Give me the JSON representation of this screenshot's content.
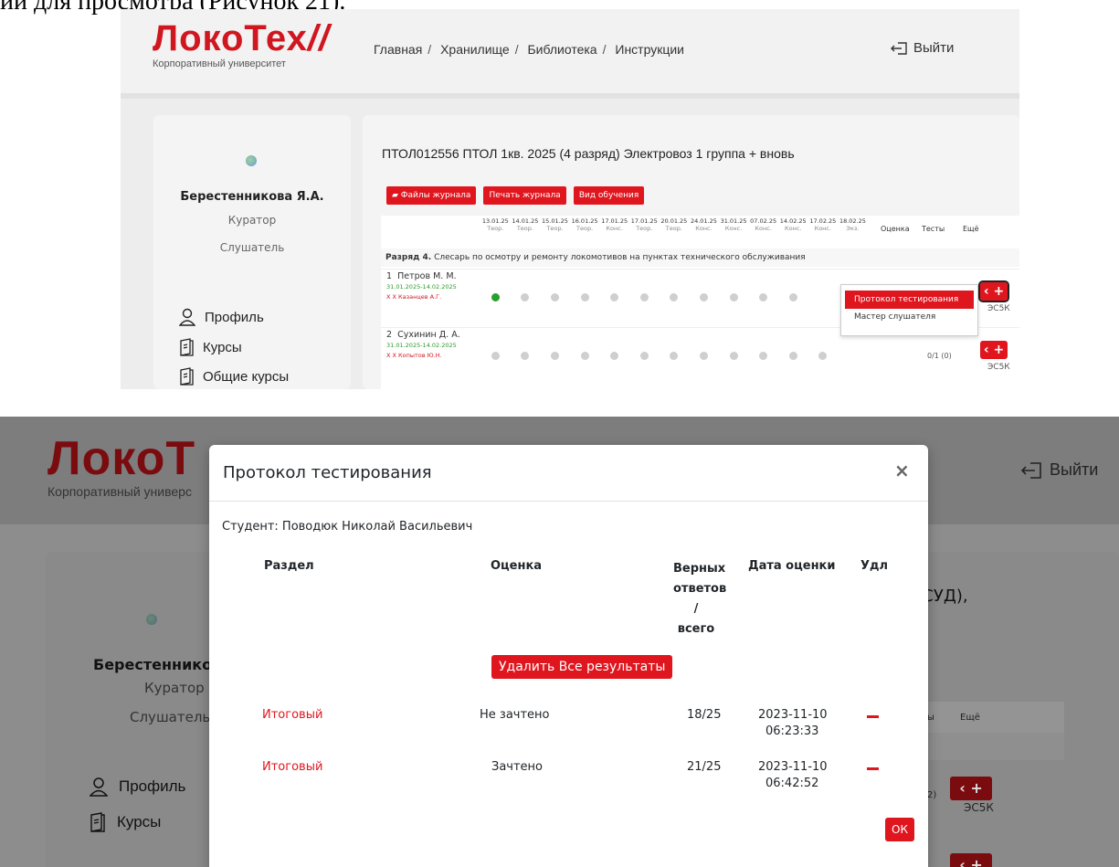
{
  "caption": "ии для просмотра (Рисунок 21).",
  "top": {
    "logo": {
      "brand": "ЛокоТех",
      "slash": "//",
      "subtitle": "Корпоративный университет"
    },
    "nav": [
      "Главная",
      "Хранилище",
      "Библиотека",
      "Инструкции"
    ],
    "logout_label": "Выйти",
    "user": {
      "name": "Берестенникова Я.А.",
      "role1": "Куратор",
      "role2": "Слушатель"
    },
    "menu": [
      "Профиль",
      "Курсы",
      "Общие курсы"
    ],
    "course_title": "ПТОЛ012556  ПТОЛ 1кв. 2025 (4 разряд) Электровоз 1 группа + вновь",
    "buttons": {
      "files": "Файлы журнала",
      "print": "Печать журнала",
      "study": "Вид обучения"
    },
    "dates": [
      {
        "d": "13.01.25",
        "t": "Теор."
      },
      {
        "d": "14.01.25",
        "t": "Теор."
      },
      {
        "d": "15.01.25",
        "t": "Теор."
      },
      {
        "d": "16.01.25",
        "t": "Теор."
      },
      {
        "d": "17.01.25",
        "t": "Конс."
      },
      {
        "d": "17.01.25",
        "t": "Теор."
      },
      {
        "d": "20.01.25",
        "t": "Теор."
      },
      {
        "d": "24.01.25",
        "t": "Конс."
      },
      {
        "d": "31.01.25",
        "t": "Конс."
      },
      {
        "d": "07.02.25",
        "t": "Конс."
      },
      {
        "d": "14.02.25",
        "t": "Конс."
      },
      {
        "d": "17.02.25",
        "t": "Конс."
      },
      {
        "d": "18.02.25",
        "t": "Экз."
      }
    ],
    "headers": {
      "grade": "Оценка",
      "tests": "Тесты",
      "more": "Ещё"
    },
    "rank": {
      "bold": "Разряд 4.",
      "text": " Слесарь по осмотру и ремонту локомотивов на пунктах технического обслуживания"
    },
    "students": [
      {
        "num": "1",
        "name": "Петров М. М.",
        "dates": "31.01.2025-14.02.2025",
        "curator": "Х Х Казанцев А.Г.",
        "tests": "",
        "label": "ЭС5К"
      },
      {
        "num": "2",
        "name": "Сухинин Д. А.",
        "dates": "31.01.2025-14.02.2025",
        "curator": "Х Х Копытов Ю.Н.",
        "tests": "0/1 (0)",
        "label": "ЭС5К"
      }
    ],
    "dropdown": {
      "active": "Протокол тестирования",
      "item": "Мастер слушателя"
    }
  },
  "bottom": {
    "logo": {
      "brand": "ЛокоТ",
      "subtitle": "Корпоративный универс"
    },
    "logout_label": "Выйти",
    "user": {
      "name": "Берестенников",
      "role1": "Куратор",
      "role2": "Слушатель"
    },
    "menu": [
      "Профиль",
      "Курсы"
    ],
    "bg_title_fragment": "ІСУД),",
    "bg_header_fragment": "ы",
    "bg_more": "Ещё",
    "bg_label": "ЭС5К",
    "bg_partial": "2)",
    "modal": {
      "title": "Протокол тестирования",
      "close": "×",
      "student": "Студент: Поводюк Николай Васильевич",
      "columns": {
        "section": "Раздел",
        "grade": "Оценка",
        "correct_l1": "Верных",
        "correct_l2": "ответов",
        "correct_l3": "/",
        "correct_l4": "всего",
        "date": "Дата оценки",
        "del": "Удл"
      },
      "delete_all": "Удалить Все результаты",
      "rows": [
        {
          "section": "Итоговый",
          "grade": "Не зачтено",
          "score": "18/25",
          "date": "2023-11-10",
          "time": "06:23:33"
        },
        {
          "section": "Итоговый",
          "grade": "Зачтено",
          "score": "21/25",
          "date": "2023-11-10",
          "time": "06:42:52"
        }
      ],
      "ok": "ОК"
    }
  }
}
